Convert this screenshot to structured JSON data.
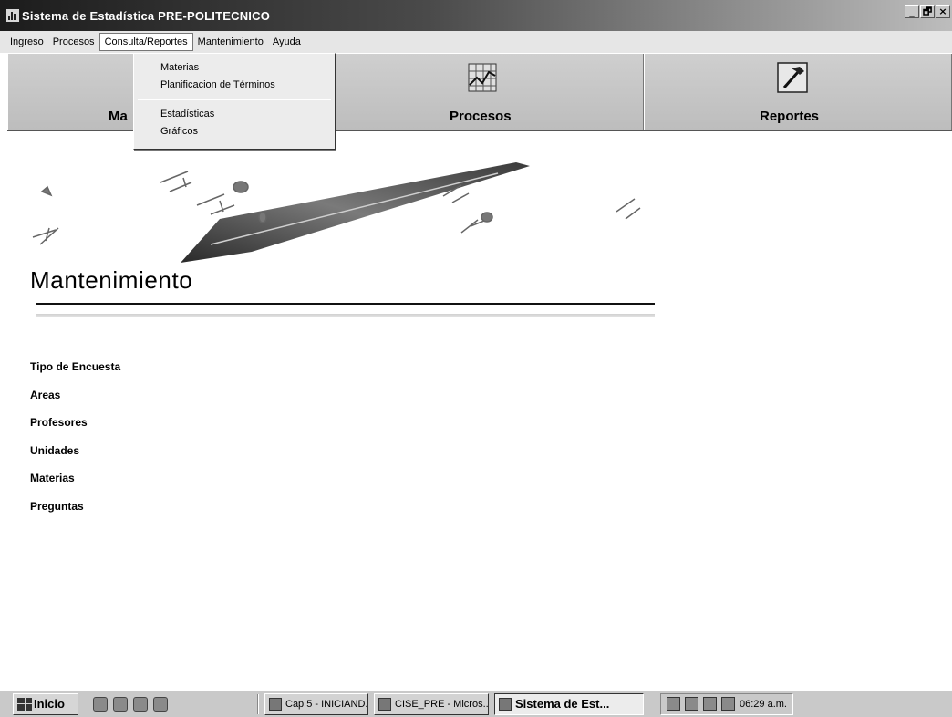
{
  "window": {
    "title": "Sistema de Estadística PRE-POLITECNICO",
    "controls": {
      "minimize": "_",
      "maximize": "🗗",
      "close": "×"
    }
  },
  "menubar": {
    "items": [
      "Ingreso",
      "Procesos",
      "Consulta/Reportes",
      "Mantenimiento",
      "Ayuda"
    ],
    "open_item": "Consulta/Reportes"
  },
  "dropdown": {
    "items": [
      "Materias",
      "Planificacion de Términos",
      "Estadísticas",
      "Gráficos"
    ]
  },
  "toolbar": {
    "buttons": [
      {
        "label": "Ma",
        "icon": "maintenance-icon"
      },
      {
        "label": "Procesos",
        "icon": "chart-icon"
      },
      {
        "label": "Reportes",
        "icon": "hammer-icon"
      }
    ]
  },
  "content": {
    "title": "Mantenimiento",
    "links": [
      "Tipo de Encuesta",
      "Areas",
      "Profesores",
      "Unidades",
      "Materias",
      "Preguntas"
    ]
  },
  "taskbar": {
    "start_label": "Inicio",
    "tasks": [
      "Cap  5 - INICIAND...",
      "CISE_PRE - Micros...",
      "Sistema de Est..."
    ],
    "active_task": "Sistema de Est...",
    "clock": "06:29 a.m."
  }
}
